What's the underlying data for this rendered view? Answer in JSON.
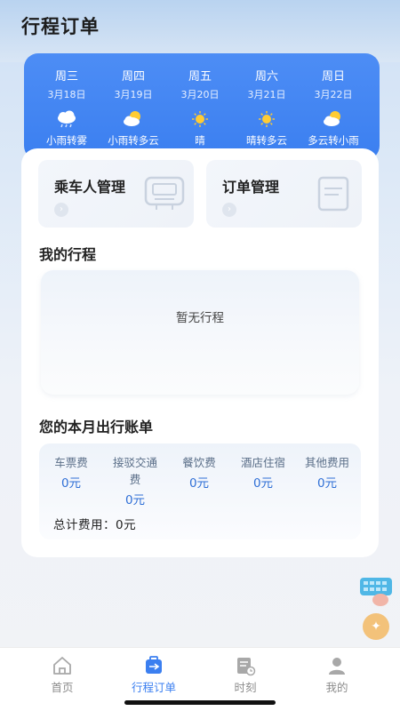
{
  "header": {
    "title": "行程订单"
  },
  "weather": [
    {
      "weekday": "周三",
      "date": "3月18日",
      "condition": "小雨转雾",
      "icon": "cloud-rain-icon"
    },
    {
      "weekday": "周四",
      "date": "3月19日",
      "condition": "小雨转多云",
      "icon": "partly-cloudy-icon"
    },
    {
      "weekday": "周五",
      "date": "3月20日",
      "condition": "晴",
      "icon": "sun-icon"
    },
    {
      "weekday": "周六",
      "date": "3月21日",
      "condition": "晴转多云",
      "icon": "sun-icon"
    },
    {
      "weekday": "周日",
      "date": "3月22日",
      "condition": "多云转小雨",
      "icon": "partly-cloudy-icon"
    }
  ],
  "quick_actions": [
    {
      "label": "乘车人管理",
      "icon": "passenger-card-icon"
    },
    {
      "label": "订单管理",
      "icon": "order-doc-icon"
    }
  ],
  "my_trips": {
    "title": "我的行程",
    "empty_text": "暂无行程"
  },
  "monthly_bill": {
    "title": "您的本月出行账单",
    "items": [
      {
        "name": "车票费",
        "value": "0元"
      },
      {
        "name": "接驳交通费",
        "value": "0元"
      },
      {
        "name": "餐饮费",
        "value": "0元"
      },
      {
        "name": "酒店住宿",
        "value": "0元"
      },
      {
        "name": "其他费用",
        "value": "0元"
      }
    ],
    "total_label": "总计费用：",
    "total_value": "0元"
  },
  "tabbar": [
    {
      "label": "首页",
      "icon": "home-icon",
      "active": false
    },
    {
      "label": "行程订单",
      "icon": "briefcase-plane-icon",
      "active": true
    },
    {
      "label": "时刻",
      "icon": "timetable-icon",
      "active": false
    },
    {
      "label": "我的",
      "icon": "user-icon",
      "active": false
    }
  ],
  "colors": {
    "accent": "#3b7ff0",
    "bill_value": "#2f6fd6"
  }
}
